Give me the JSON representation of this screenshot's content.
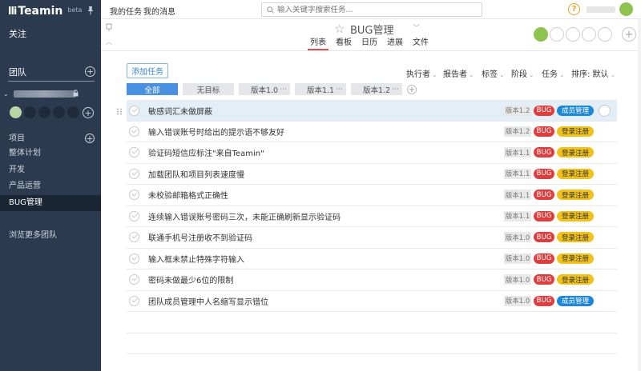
{
  "app": {
    "logo_mark": "lli",
    "logo_text": "Teamin",
    "logo_beta": "beta"
  },
  "sidebar": {
    "follow": "关注",
    "team_label": "团队",
    "items": [
      "项目",
      "整体计划",
      "开发",
      "产品运营",
      "BUG管理"
    ],
    "active_item": "BUG管理",
    "browse_more": "浏览更多团队"
  },
  "topbar": {
    "my_tasks": "我的任务",
    "my_messages": "我的消息",
    "search_placeholder": "输入关键字搜索任务...",
    "help": "?"
  },
  "project": {
    "title": "BUG管理",
    "tabs": [
      "列表",
      "看板",
      "日历",
      "进展",
      "文件"
    ],
    "active_tab": "列表"
  },
  "toolbar": {
    "add_task": "添加任务",
    "filters": [
      "执行者",
      "报告者",
      "标签",
      "阶段",
      "任务"
    ],
    "sort_label": "排序: 默认"
  },
  "chips": [
    {
      "label": "全部",
      "active": true,
      "dots": ""
    },
    {
      "label": "无目标",
      "active": false,
      "dots": ""
    },
    {
      "label": "版本1.0",
      "active": false,
      "dots": "···"
    },
    {
      "label": "版本1.1",
      "active": false,
      "dots": "···"
    },
    {
      "label": "版本1.2",
      "active": false,
      "dots": "···"
    }
  ],
  "tasks": [
    {
      "title": "敏感词汇未做屏蔽",
      "version": "版本1.2",
      "bug": "BUG",
      "module": "成员管理",
      "module_color": "blue",
      "selected": true
    },
    {
      "title": "输入错误账号时给出的提示语不够友好",
      "version": "版本1.2",
      "bug": "BUG",
      "module": "登录注册",
      "module_color": "yellow",
      "selected": false
    },
    {
      "title": "验证码短信应标注\"来自Teamin\"",
      "version": "版本1.1",
      "bug": "BUG",
      "module": "登录注册",
      "module_color": "yellow",
      "selected": false
    },
    {
      "title": "加载团队和项目列表速度慢",
      "version": "版本1.1",
      "bug": "BUG",
      "module": "登录注册",
      "module_color": "yellow",
      "selected": false
    },
    {
      "title": "未校验邮箱格式正确性",
      "version": "版本1.1",
      "bug": "BUG",
      "module": "登录注册",
      "module_color": "yellow",
      "selected": false
    },
    {
      "title": "连续输入错误账号密码三次，未能正确刷新显示验证码",
      "version": "版本1.1",
      "bug": "BUG",
      "module": "登录注册",
      "module_color": "yellow",
      "selected": false
    },
    {
      "title": "联通手机号注册收不到验证码",
      "version": "版本1.0",
      "bug": "BUG",
      "module": "登录注册",
      "module_color": "yellow",
      "selected": false
    },
    {
      "title": "输入框未禁止特殊字符输入",
      "version": "版本1.0",
      "bug": "BUG",
      "module": "登录注册",
      "module_color": "yellow",
      "selected": false
    },
    {
      "title": "密码未做最少6位的限制",
      "version": "版本1.0",
      "bug": "BUG",
      "module": "登录注册",
      "module_color": "yellow",
      "selected": false
    },
    {
      "title": "团队成员管理中人名缩写显示错位",
      "version": "版本1.0",
      "bug": "BUG",
      "module": "成员管理",
      "module_color": "blue",
      "selected": false
    }
  ]
}
